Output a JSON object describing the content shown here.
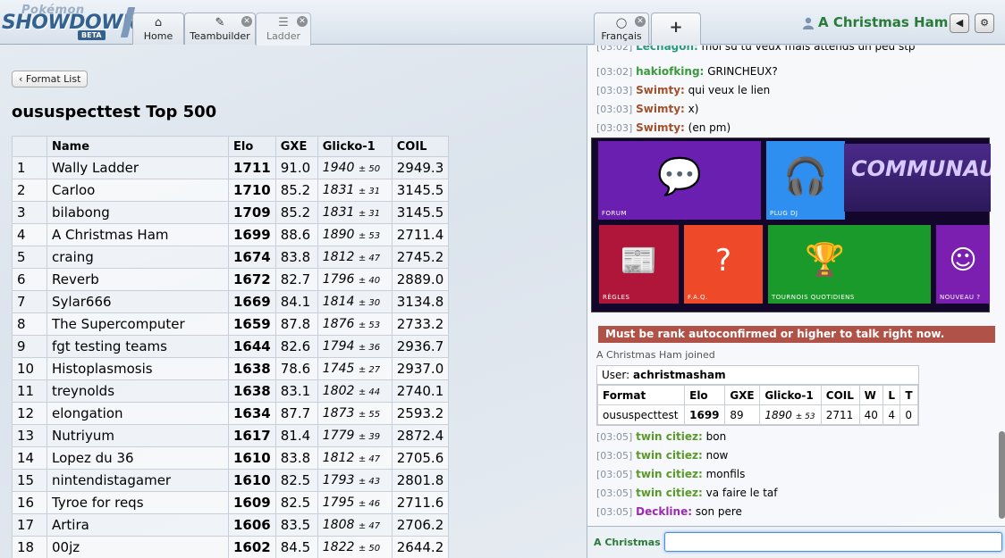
{
  "brand": {
    "line1": "Pokémon",
    "line2": "SHOWDOWN",
    "badge": "BETA"
  },
  "tabs": [
    {
      "icon": "home-icon",
      "glyph": "⌂",
      "label": "Home"
    },
    {
      "icon": "edit-icon",
      "glyph": "✎",
      "label": "Teambuilder"
    },
    {
      "icon": "list-icon",
      "glyph": "☰",
      "label": "Ladder"
    }
  ],
  "room_tabs": [
    {
      "icon": "chat-bubble-icon",
      "glyph": "💬",
      "label": "Français"
    },
    {
      "icon": "plus-icon",
      "glyph": "+",
      "label": ""
    }
  ],
  "user": {
    "name": "A Christmas Ham",
    "volume_glyph": "◀",
    "settings_glyph": "⚙"
  },
  "ladder": {
    "back_label": "‹ Format List",
    "title": "oususpecttest Top 500",
    "headers": [
      "",
      "Name",
      "Elo",
      "GXE",
      "Glicko-1",
      "COIL"
    ],
    "rows": [
      {
        "rank": "1",
        "name": "Wally Ladder",
        "elo": "1711",
        "gxe": "91.0",
        "glicko": "1940",
        "dev": "± 50",
        "coil": "2949.3"
      },
      {
        "rank": "2",
        "name": "Carloo",
        "elo": "1710",
        "gxe": "85.2",
        "glicko": "1831",
        "dev": "± 31",
        "coil": "3145.5"
      },
      {
        "rank": "3",
        "name": "bilabong",
        "elo": "1709",
        "gxe": "85.2",
        "glicko": "1831",
        "dev": "± 31",
        "coil": "3145.5"
      },
      {
        "rank": "4",
        "name": "A Christmas Ham",
        "elo": "1699",
        "gxe": "88.6",
        "glicko": "1890",
        "dev": "± 53",
        "coil": "2711.4"
      },
      {
        "rank": "5",
        "name": "craing",
        "elo": "1674",
        "gxe": "83.8",
        "glicko": "1812",
        "dev": "± 47",
        "coil": "2745.2"
      },
      {
        "rank": "6",
        "name": "Reverb",
        "elo": "1672",
        "gxe": "82.7",
        "glicko": "1796",
        "dev": "± 40",
        "coil": "2889.0"
      },
      {
        "rank": "7",
        "name": "Sylar666",
        "elo": "1669",
        "gxe": "84.1",
        "glicko": "1814",
        "dev": "± 30",
        "coil": "3134.8"
      },
      {
        "rank": "8",
        "name": "The Supercomputer",
        "elo": "1659",
        "gxe": "87.8",
        "glicko": "1876",
        "dev": "± 53",
        "coil": "2733.2"
      },
      {
        "rank": "9",
        "name": "fgt testing teams",
        "elo": "1644",
        "gxe": "82.6",
        "glicko": "1794",
        "dev": "± 36",
        "coil": "2936.7"
      },
      {
        "rank": "10",
        "name": "Histoplasmosis",
        "elo": "1638",
        "gxe": "78.6",
        "glicko": "1745",
        "dev": "± 27",
        "coil": "2937.0"
      },
      {
        "rank": "11",
        "name": "treynolds",
        "elo": "1638",
        "gxe": "83.1",
        "glicko": "1802",
        "dev": "± 44",
        "coil": "2740.1"
      },
      {
        "rank": "12",
        "name": "elongation",
        "elo": "1634",
        "gxe": "87.7",
        "glicko": "1873",
        "dev": "± 55",
        "coil": "2593.2"
      },
      {
        "rank": "13",
        "name": "Nutriyum",
        "elo": "1617",
        "gxe": "81.4",
        "glicko": "1779",
        "dev": "± 39",
        "coil": "2872.4"
      },
      {
        "rank": "14",
        "name": "Lopez du 36",
        "elo": "1610",
        "gxe": "83.8",
        "glicko": "1812",
        "dev": "± 47",
        "coil": "2705.6"
      },
      {
        "rank": "15",
        "name": "nintendistagamer",
        "elo": "1610",
        "gxe": "82.5",
        "glicko": "1793",
        "dev": "± 43",
        "coil": "2801.8"
      },
      {
        "rank": "16",
        "name": "Tyroe for reqs",
        "elo": "1609",
        "gxe": "82.5",
        "glicko": "1795",
        "dev": "± 46",
        "coil": "2711.6"
      },
      {
        "rank": "17",
        "name": "Artira",
        "elo": "1606",
        "gxe": "83.5",
        "glicko": "1808",
        "dev": "± 47",
        "coil": "2706.2"
      },
      {
        "rank": "18",
        "name": "00jz",
        "elo": "1602",
        "gxe": "84.5",
        "glicko": "1822",
        "dev": "± 50",
        "coil": "2644.2"
      }
    ]
  },
  "chat": {
    "top_messages": [
      {
        "ts": "[03:02]",
        "who": "Lechagon:",
        "color": "#2a9a7a",
        "text": "moi su tu veux mais attends un peu stp"
      },
      {
        "ts": "[03:02]",
        "who": "hakiofking:",
        "color": "#3a9a3a",
        "text": "GRINCHEUX?"
      },
      {
        "ts": "[03:03]",
        "who": "Swimty:",
        "color": "#a0522d",
        "text": "qui veux le lien"
      },
      {
        "ts": "[03:03]",
        "who": "Swimty:",
        "color": "#a0522d",
        "text": "x)"
      },
      {
        "ts": "[03:03]",
        "who": "Swimty:",
        "color": "#a0522d",
        "text": "(en pm)"
      }
    ],
    "banner": {
      "tiles": [
        {
          "label": "FORUM",
          "color": "#6a1fb0"
        },
        {
          "label": "PLUG DJ",
          "color": "#2f8ff0"
        },
        {
          "label": "RÈGLES",
          "color": "#b0153a"
        },
        {
          "label": "F.A.Q.",
          "color": "#ee4a2a"
        },
        {
          "label": "TOURNOIS QUOTIDIENS",
          "color": "#1a9a2a"
        },
        {
          "label": "NOUVEAU ?",
          "color": "#7a1fb0"
        }
      ],
      "community_text": "COMMUNAUTÉ"
    },
    "warning": "Must be rank autoconfirmed or higher to talk right now.",
    "joined": "A Christmas Ham joined",
    "user_card": {
      "user_label": "User:",
      "user_value": "achristmasham",
      "headers": [
        "Format",
        "Elo",
        "GXE",
        "Glicko-1",
        "COIL",
        "W",
        "L",
        "T"
      ],
      "row": {
        "format": "oususpecttest",
        "elo": "1699",
        "gxe": "89",
        "glicko": "1890",
        "dev": "± 53",
        "coil": "2711",
        "w": "40",
        "l": "4",
        "t": "0"
      }
    },
    "bottom_messages": [
      {
        "ts": "[03:05]",
        "who": "twin citiez:",
        "color": "#5a9a2a",
        "text": "bon"
      },
      {
        "ts": "[03:05]",
        "who": "twin citiez:",
        "color": "#5a9a2a",
        "text": "now"
      },
      {
        "ts": "[03:05]",
        "who": "twin citiez:",
        "color": "#5a9a2a",
        "text": "monfils"
      },
      {
        "ts": "[03:05]",
        "who": "twin citiez:",
        "color": "#5a9a2a",
        "text": "va faire le taf"
      },
      {
        "ts": "[03:05]",
        "who": "Deckline:",
        "color": "#9a2ab0",
        "text": "son pere"
      }
    ],
    "input_name": "A Christmas",
    "input_value": ""
  }
}
